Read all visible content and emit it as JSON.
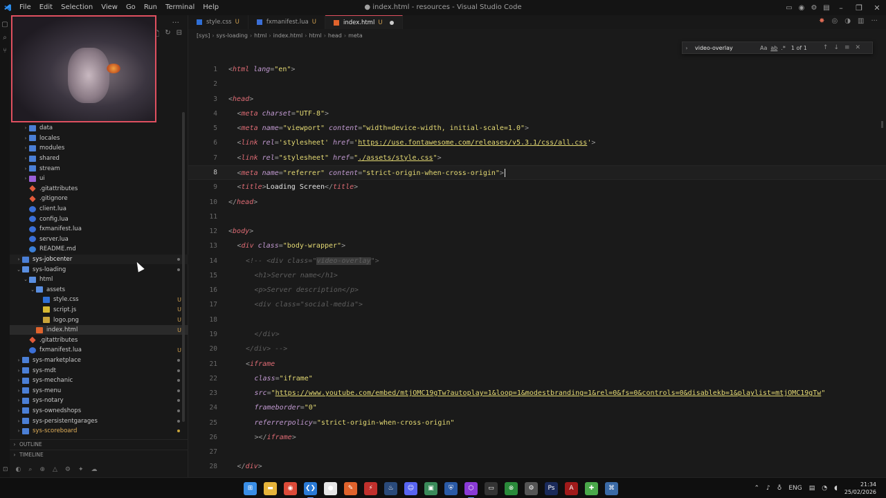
{
  "window": {
    "title": "● index.html - resources - Visual Studio Code",
    "menu": [
      "File",
      "Edit",
      "Selection",
      "View",
      "Go",
      "Run",
      "Terminal",
      "Help"
    ]
  },
  "tabs": [
    {
      "label": "style.css",
      "status": "U",
      "icon_color": "#2f6fd6"
    },
    {
      "label": "fxmanifest.lua",
      "status": "U",
      "icon_color": "#3b6fd6"
    },
    {
      "label": "index.html",
      "status": "U",
      "icon_color": "#e0632c",
      "active": true,
      "modified": true
    }
  ],
  "breadcrumbs": [
    "[sys]",
    "sys-loading",
    "html",
    "index.html",
    "html",
    "head",
    "meta"
  ],
  "find_widget": {
    "query": "video-overlay",
    "options": [
      "Aa",
      "ab",
      ".*"
    ],
    "count": "1 of 1"
  },
  "explorer": {
    "items": [
      {
        "name": "data",
        "type": "folder",
        "depth": 1
      },
      {
        "name": "locales",
        "type": "folder",
        "depth": 1
      },
      {
        "name": "modules",
        "type": "folder",
        "depth": 1
      },
      {
        "name": "shared",
        "type": "folder",
        "depth": 1
      },
      {
        "name": "stream",
        "type": "folder",
        "depth": 1
      },
      {
        "name": "ui",
        "type": "folder-purple",
        "depth": 1
      },
      {
        "name": ".gitattributes",
        "type": "git",
        "depth": 1
      },
      {
        "name": ".gitignore",
        "type": "git",
        "depth": 1
      },
      {
        "name": "client.lua",
        "type": "lua",
        "depth": 1
      },
      {
        "name": "config.lua",
        "type": "lua",
        "depth": 1
      },
      {
        "name": "fxmanifest.lua",
        "type": "lua",
        "depth": 1
      },
      {
        "name": "server.lua",
        "type": "lua",
        "depth": 1
      },
      {
        "name": "README.md",
        "type": "info",
        "depth": 1
      },
      {
        "name": "sys-jobcenter",
        "type": "folder",
        "depth": 0,
        "style": "bold",
        "hover": true
      },
      {
        "name": "sys-loading",
        "type": "folder-open",
        "depth": 0
      },
      {
        "name": "html",
        "type": "folder-open",
        "depth": 1
      },
      {
        "name": "assets",
        "type": "folder-open",
        "depth": 2
      },
      {
        "name": "style.css",
        "type": "css",
        "depth": 3,
        "status": "U"
      },
      {
        "name": "script.js",
        "type": "js",
        "depth": 3,
        "status": "U"
      },
      {
        "name": "logo.png",
        "type": "png",
        "depth": 3,
        "status": "U"
      },
      {
        "name": "index.html",
        "type": "html",
        "depth": 2,
        "status": "U",
        "selected": true
      },
      {
        "name": ".gitattributes",
        "type": "git",
        "depth": 1
      },
      {
        "name": "fxmanifest.lua",
        "type": "lua",
        "depth": 1,
        "status": "U"
      },
      {
        "name": "sys-marketplace",
        "type": "folder",
        "depth": 0
      },
      {
        "name": "sys-mdt",
        "type": "folder",
        "depth": 0
      },
      {
        "name": "sys-mechanic",
        "type": "folder",
        "depth": 0
      },
      {
        "name": "sys-menu",
        "type": "folder",
        "depth": 0
      },
      {
        "name": "sys-notary",
        "type": "folder",
        "depth": 0
      },
      {
        "name": "sys-ownedshops",
        "type": "folder",
        "depth": 0
      },
      {
        "name": "sys-persistentgarages",
        "type": "folder",
        "depth": 0
      },
      {
        "name": "sys-scoreboard",
        "type": "folder",
        "depth": 0,
        "style": "orange"
      }
    ],
    "sections": [
      "OUTLINE",
      "TIMELINE"
    ]
  },
  "code": {
    "current_line": 8,
    "lines": [
      {
        "n": "1",
        "segments": [
          [
            "t-pun",
            "<"
          ],
          [
            "t-tag",
            "html"
          ],
          [
            "t-txt",
            " "
          ],
          [
            "t-attr",
            "lang"
          ],
          [
            "t-pun",
            "="
          ],
          [
            "t-str",
            "\"en\""
          ],
          [
            "t-pun",
            ">"
          ]
        ]
      },
      {
        "n": "2",
        "segments": []
      },
      {
        "n": "3",
        "segments": [
          [
            "t-pun",
            "<"
          ],
          [
            "t-tag",
            "head"
          ],
          [
            "t-pun",
            ">"
          ]
        ]
      },
      {
        "n": "4",
        "indent": 1,
        "segments": [
          [
            "t-pun",
            "<"
          ],
          [
            "t-tag",
            "meta"
          ],
          [
            "t-txt",
            " "
          ],
          [
            "t-attr",
            "charset"
          ],
          [
            "t-pun",
            "="
          ],
          [
            "t-str",
            "\"UTF-8\""
          ],
          [
            "t-pun",
            ">"
          ]
        ]
      },
      {
        "n": "5",
        "indent": 1,
        "segments": [
          [
            "t-pun",
            "<"
          ],
          [
            "t-tag",
            "meta"
          ],
          [
            "t-txt",
            " "
          ],
          [
            "t-attr",
            "name"
          ],
          [
            "t-pun",
            "="
          ],
          [
            "t-str",
            "\"viewport\""
          ],
          [
            "t-txt",
            " "
          ],
          [
            "t-attr",
            "content"
          ],
          [
            "t-pun",
            "="
          ],
          [
            "t-str",
            "\"width=device-width, initial-scale=1.0\""
          ],
          [
            "t-pun",
            ">"
          ]
        ]
      },
      {
        "n": "6",
        "indent": 1,
        "segments": [
          [
            "t-pun",
            "<"
          ],
          [
            "t-tag",
            "link"
          ],
          [
            "t-txt",
            " "
          ],
          [
            "t-attr",
            "rel"
          ],
          [
            "t-pun",
            "="
          ],
          [
            "t-str",
            "'stylesheet'"
          ],
          [
            "t-txt",
            " "
          ],
          [
            "t-attr",
            "href"
          ],
          [
            "t-pun",
            "="
          ],
          [
            "t-str",
            "'"
          ],
          [
            "t-url",
            "https://use.fontawesome.com/releases/v5.3.1/css/all.css"
          ],
          [
            "t-str",
            "'"
          ],
          [
            "t-pun",
            ">"
          ]
        ]
      },
      {
        "n": "7",
        "indent": 1,
        "segments": [
          [
            "t-pun",
            "<"
          ],
          [
            "t-tag",
            "link"
          ],
          [
            "t-txt",
            " "
          ],
          [
            "t-attr",
            "rel"
          ],
          [
            "t-pun",
            "="
          ],
          [
            "t-str",
            "\"stylesheet\""
          ],
          [
            "t-txt",
            " "
          ],
          [
            "t-attr",
            "href"
          ],
          [
            "t-pun",
            "="
          ],
          [
            "t-str",
            "\""
          ],
          [
            "t-url",
            "./assets/style.css"
          ],
          [
            "t-str",
            "\""
          ],
          [
            "t-pun",
            ">"
          ]
        ]
      },
      {
        "n": "8",
        "indent": 1,
        "segments": [
          [
            "t-pun",
            "<"
          ],
          [
            "t-tag",
            "meta"
          ],
          [
            "t-txt",
            " "
          ],
          [
            "t-attr",
            "name"
          ],
          [
            "t-pun",
            "="
          ],
          [
            "t-str",
            "\"referrer\""
          ],
          [
            "t-txt",
            " "
          ],
          [
            "t-attr",
            "content"
          ],
          [
            "t-pun",
            "="
          ],
          [
            "t-str",
            "\"strict-origin-when-cross-origin\""
          ],
          [
            "t-pun",
            ">"
          ]
        ],
        "cursor": true
      },
      {
        "n": "9",
        "indent": 1,
        "segments": [
          [
            "t-pun",
            "<"
          ],
          [
            "t-tag",
            "title"
          ],
          [
            "t-pun",
            ">"
          ],
          [
            "t-txt",
            "Loading Screen"
          ],
          [
            "t-pun",
            "</"
          ],
          [
            "t-tag",
            "title"
          ],
          [
            "t-pun",
            ">"
          ]
        ]
      },
      {
        "n": "10",
        "segments": [
          [
            "t-pun",
            "</"
          ],
          [
            "t-tag",
            "head"
          ],
          [
            "t-pun",
            ">"
          ]
        ]
      },
      {
        "n": "11",
        "segments": []
      },
      {
        "n": "12",
        "segments": [
          [
            "t-pun",
            "<"
          ],
          [
            "t-tag",
            "body"
          ],
          [
            "t-pun",
            ">"
          ]
        ]
      },
      {
        "n": "13",
        "indent": 1,
        "segments": [
          [
            "t-pun",
            "<"
          ],
          [
            "t-tag",
            "div"
          ],
          [
            "t-txt",
            " "
          ],
          [
            "t-attr",
            "class"
          ],
          [
            "t-pun",
            "="
          ],
          [
            "t-str",
            "\"body-wrapper\""
          ],
          [
            "t-pun",
            ">"
          ]
        ]
      },
      {
        "n": "14",
        "indent": 2,
        "segments": [
          [
            "t-cmt",
            "<!-- <div class=\""
          ],
          [
            "t-cmt t-sel",
            "video-overlay"
          ],
          [
            "t-cmt",
            "\">"
          ]
        ]
      },
      {
        "n": "15",
        "indent": 3,
        "segments": [
          [
            "t-cmt",
            "<h1>Server name</h1>"
          ]
        ]
      },
      {
        "n": "16",
        "indent": 3,
        "segments": [
          [
            "t-cmt",
            "<p>Server description</p>"
          ]
        ]
      },
      {
        "n": "17",
        "indent": 3,
        "segments": [
          [
            "t-cmt",
            "<div class=\"social-media\">"
          ]
        ]
      },
      {
        "n": "18",
        "segments": []
      },
      {
        "n": "19",
        "indent": 3,
        "segments": [
          [
            "t-cmt",
            "</div>"
          ]
        ]
      },
      {
        "n": "20",
        "indent": 2,
        "segments": [
          [
            "t-cmt",
            "</div> -->"
          ]
        ]
      },
      {
        "n": "21",
        "indent": 2,
        "segments": [
          [
            "t-pun",
            "<"
          ],
          [
            "t-tag",
            "iframe"
          ]
        ]
      },
      {
        "n": "22",
        "indent": 3,
        "segments": [
          [
            "t-attr",
            "class"
          ],
          [
            "t-pun",
            "="
          ],
          [
            "t-str",
            "\"iframe\""
          ]
        ]
      },
      {
        "n": "23",
        "indent": 3,
        "segments": [
          [
            "t-attr",
            "src"
          ],
          [
            "t-pun",
            "="
          ],
          [
            "t-str",
            "\""
          ],
          [
            "t-url",
            "https://www.youtube.com/embed/mtjOMC19gTw?autoplay=1&loop=1&modestbranding=1&rel=0&fs=0&controls=0&disablekb=1&playlist=mtjOMC19gTw"
          ],
          [
            "t-str",
            "\""
          ]
        ]
      },
      {
        "n": "24",
        "indent": 3,
        "segments": [
          [
            "t-attr",
            "frameborder"
          ],
          [
            "t-pun",
            "="
          ],
          [
            "t-str",
            "\"0\""
          ]
        ]
      },
      {
        "n": "25",
        "indent": 3,
        "segments": [
          [
            "t-attr",
            "referrerpolicy"
          ],
          [
            "t-pun",
            "="
          ],
          [
            "t-str",
            "\"strict-origin-when-cross-origin\""
          ]
        ]
      },
      {
        "n": "26",
        "indent": 3,
        "segments": [
          [
            "t-pun",
            "></"
          ],
          [
            "t-tag",
            "iframe"
          ],
          [
            "t-pun",
            ">"
          ]
        ]
      },
      {
        "n": "27",
        "segments": []
      },
      {
        "n": "28",
        "indent": 1,
        "segments": [
          [
            "t-pun",
            "</"
          ],
          [
            "t-tag",
            "div"
          ],
          [
            "t-pun",
            ">"
          ]
        ]
      }
    ]
  },
  "taskbar": {
    "apps": [
      {
        "name": "windows-start",
        "color": "#3a8ee6",
        "glyph": "⊞"
      },
      {
        "name": "file-explorer",
        "color": "#e6b43a",
        "glyph": "▬"
      },
      {
        "name": "chrome",
        "color": "#dd4b39",
        "glyph": "◉"
      },
      {
        "name": "vscode",
        "color": "#2a7ad6",
        "glyph": "❮❯",
        "active": true
      },
      {
        "name": "app-white",
        "color": "#e6e6e6",
        "glyph": "●"
      },
      {
        "name": "app-orange",
        "color": "#e0632c",
        "glyph": "✎"
      },
      {
        "name": "app-red",
        "color": "#c0302c",
        "glyph": "⚡"
      },
      {
        "name": "steam",
        "color": "#2a4a7a",
        "glyph": "♨"
      },
      {
        "name": "discord",
        "color": "#5865f2",
        "glyph": "☺"
      },
      {
        "name": "app-green",
        "color": "#3a8a5a",
        "glyph": "▣"
      },
      {
        "name": "app-blue",
        "color": "#2a5aa6",
        "glyph": "⛨"
      },
      {
        "name": "app-purple",
        "color": "#8a3ad6",
        "glyph": "⬡",
        "active": true
      },
      {
        "name": "terminal",
        "color": "#333333",
        "glyph": "▭"
      },
      {
        "name": "xbox",
        "color": "#2a8a3a",
        "glyph": "⊗"
      },
      {
        "name": "app-grey",
        "color": "#555555",
        "glyph": "⚙"
      },
      {
        "name": "photoshop",
        "color": "#1a2a5a",
        "glyph": "Ps"
      },
      {
        "name": "app-adobe",
        "color": "#a01a1a",
        "glyph": "A"
      },
      {
        "name": "app-lime",
        "color": "#4aa84a",
        "glyph": "✚"
      },
      {
        "name": "app-chat",
        "color": "#3a6aa6",
        "glyph": "⌘"
      }
    ],
    "tray": {
      "lang": "ENG",
      "time": "21:34",
      "date": "25/02/2026"
    }
  }
}
